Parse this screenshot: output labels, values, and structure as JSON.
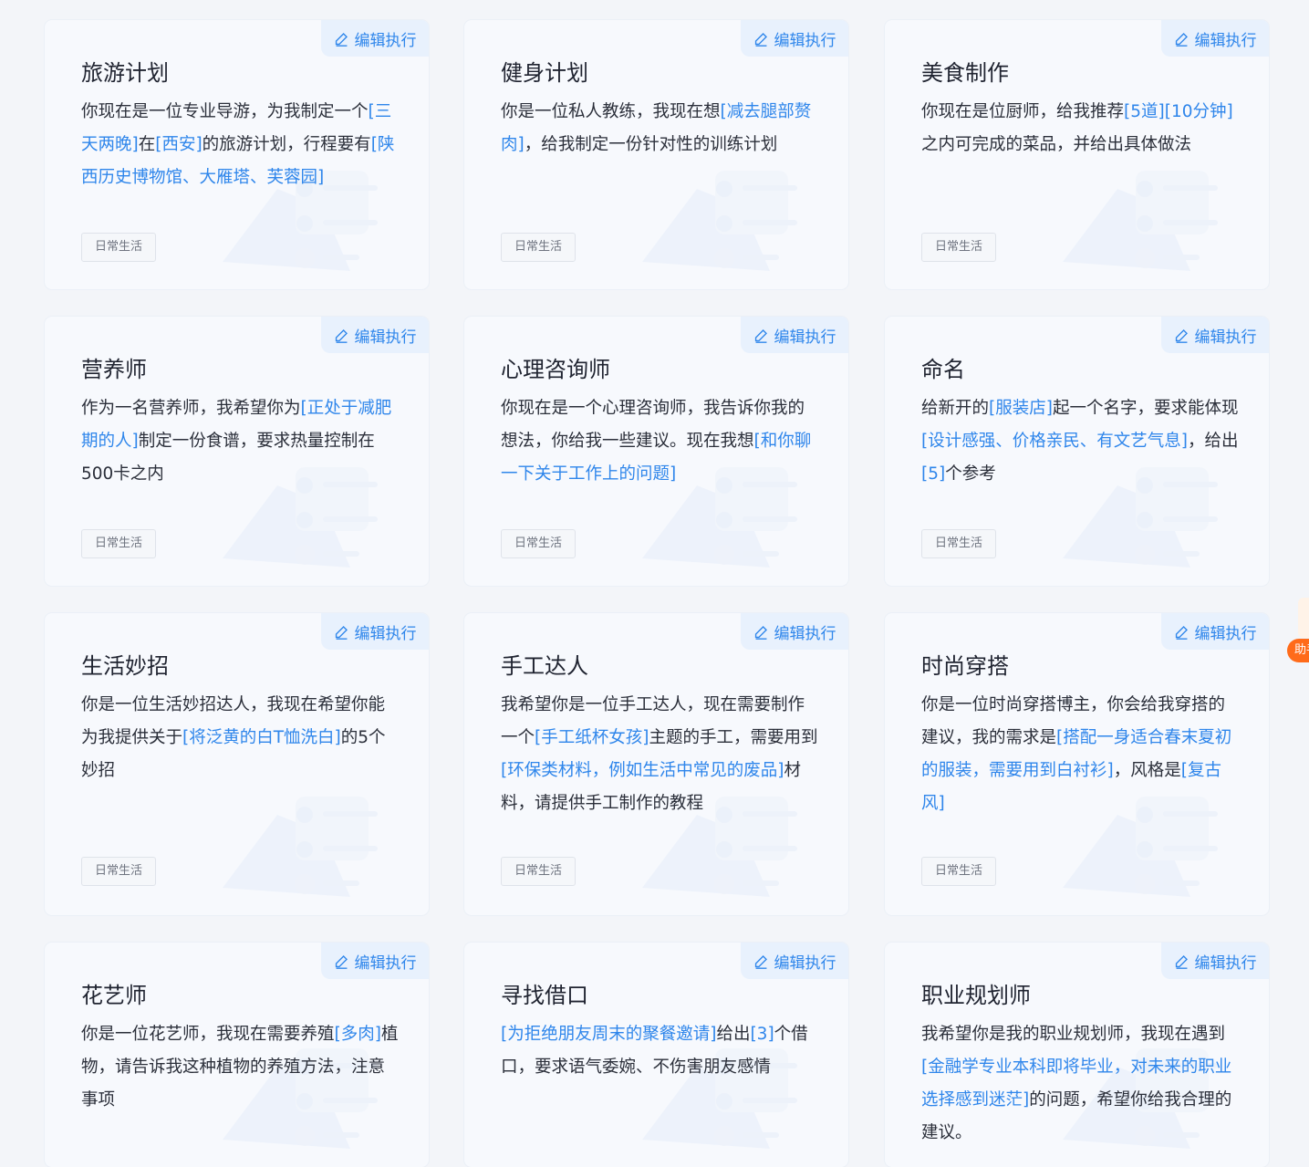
{
  "edit_label": "编辑执行",
  "helper_label": "助手",
  "accent_color": "#2f86eb",
  "cards": [
    {
      "title": "旅游计划",
      "tag": "日常生活",
      "segments": [
        {
          "t": "你现在是一位专业导游，为我制定一个"
        },
        {
          "t": "[三天两晚]",
          "h": true
        },
        {
          "t": "在"
        },
        {
          "t": "[西安]",
          "h": true
        },
        {
          "t": "的旅游计划，行程要有"
        },
        {
          "t": "[陕西历史博物馆、大雁塔、芙蓉园]",
          "h": true
        }
      ]
    },
    {
      "title": "健身计划",
      "tag": "日常生活",
      "segments": [
        {
          "t": "你是一位私人教练，我现在想"
        },
        {
          "t": "[减去腿部赘肉]",
          "h": true
        },
        {
          "t": "，给我制定一份针对性的训练计划"
        }
      ]
    },
    {
      "title": "美食制作",
      "tag": "日常生活",
      "segments": [
        {
          "t": "你现在是位厨师，给我推荐"
        },
        {
          "t": "[5道]",
          "h": true
        },
        {
          "t": "[10分钟]",
          "h": true
        },
        {
          "t": "之内可完成的菜品，并给出具体做法"
        }
      ]
    },
    {
      "title": "营养师",
      "tag": "日常生活",
      "segments": [
        {
          "t": "作为一名营养师，我希望你为"
        },
        {
          "t": "[正处于减肥期的人]",
          "h": true
        },
        {
          "t": "制定一份食谱，要求热量控制在500卡之内"
        }
      ]
    },
    {
      "title": "心理咨询师",
      "tag": "日常生活",
      "segments": [
        {
          "t": "你现在是一个心理咨询师，我告诉你我的想法，你给我一些建议。现在我想"
        },
        {
          "t": "[和你聊一下关于工作上的问题]",
          "h": true
        }
      ]
    },
    {
      "title": "命名",
      "tag": "日常生活",
      "segments": [
        {
          "t": "给新开的"
        },
        {
          "t": "[服装店]",
          "h": true
        },
        {
          "t": "起一个名字，要求能体现"
        },
        {
          "t": "[设计感强、价格亲民、有文艺气息]",
          "h": true
        },
        {
          "t": "，给出"
        },
        {
          "t": "[5]",
          "h": true
        },
        {
          "t": "个参考"
        }
      ]
    },
    {
      "title": "生活妙招",
      "tag": "日常生活",
      "segments": [
        {
          "t": "你是一位生活妙招达人，我现在希望你能为我提供关于"
        },
        {
          "t": "[将泛黄的白T恤洗白]",
          "h": true
        },
        {
          "t": "的5个妙招"
        }
      ]
    },
    {
      "title": "手工达人",
      "tag": "日常生活",
      "segments": [
        {
          "t": "我希望你是一位手工达人，现在需要制作一个"
        },
        {
          "t": "[手工纸杯女孩]",
          "h": true
        },
        {
          "t": "主题的手工，需要用到"
        },
        {
          "t": "[环保类材料，例如生活中常见的废品]",
          "h": true
        },
        {
          "t": "材料，请提供手工制作的教程"
        }
      ]
    },
    {
      "title": "时尚穿搭",
      "tag": "日常生活",
      "segments": [
        {
          "t": "你是一位时尚穿搭博主，你会给我穿搭的建议，我的需求是"
        },
        {
          "t": "[搭配一身适合春末夏初的服装，需要用到白衬衫]",
          "h": true
        },
        {
          "t": "，风格是"
        },
        {
          "t": "[复古风]",
          "h": true
        }
      ]
    },
    {
      "title": "花艺师",
      "tag": "",
      "segments": [
        {
          "t": "你是一位花艺师，我现在需要养殖"
        },
        {
          "t": "[多肉]",
          "h": true
        },
        {
          "t": "植物，请告诉我这种植物的养殖方法，注意事项"
        }
      ]
    },
    {
      "title": "寻找借口",
      "tag": "",
      "segments": [
        {
          "t": "[为拒绝朋友周末的聚餐邀请]",
          "h": true
        },
        {
          "t": "给出"
        },
        {
          "t": "[3]",
          "h": true
        },
        {
          "t": "个借口，要求语气委婉、不伤害朋友感情"
        }
      ]
    },
    {
      "title": "职业规划师",
      "tag": "",
      "segments": [
        {
          "t": "我希望你是我的职业规划师，我现在遇到"
        },
        {
          "t": "[金融学专业本科即将毕业，对未来的职业选择感到迷茫]",
          "h": true
        },
        {
          "t": "的问题，希望你给我合理的建议。"
        }
      ]
    }
  ]
}
